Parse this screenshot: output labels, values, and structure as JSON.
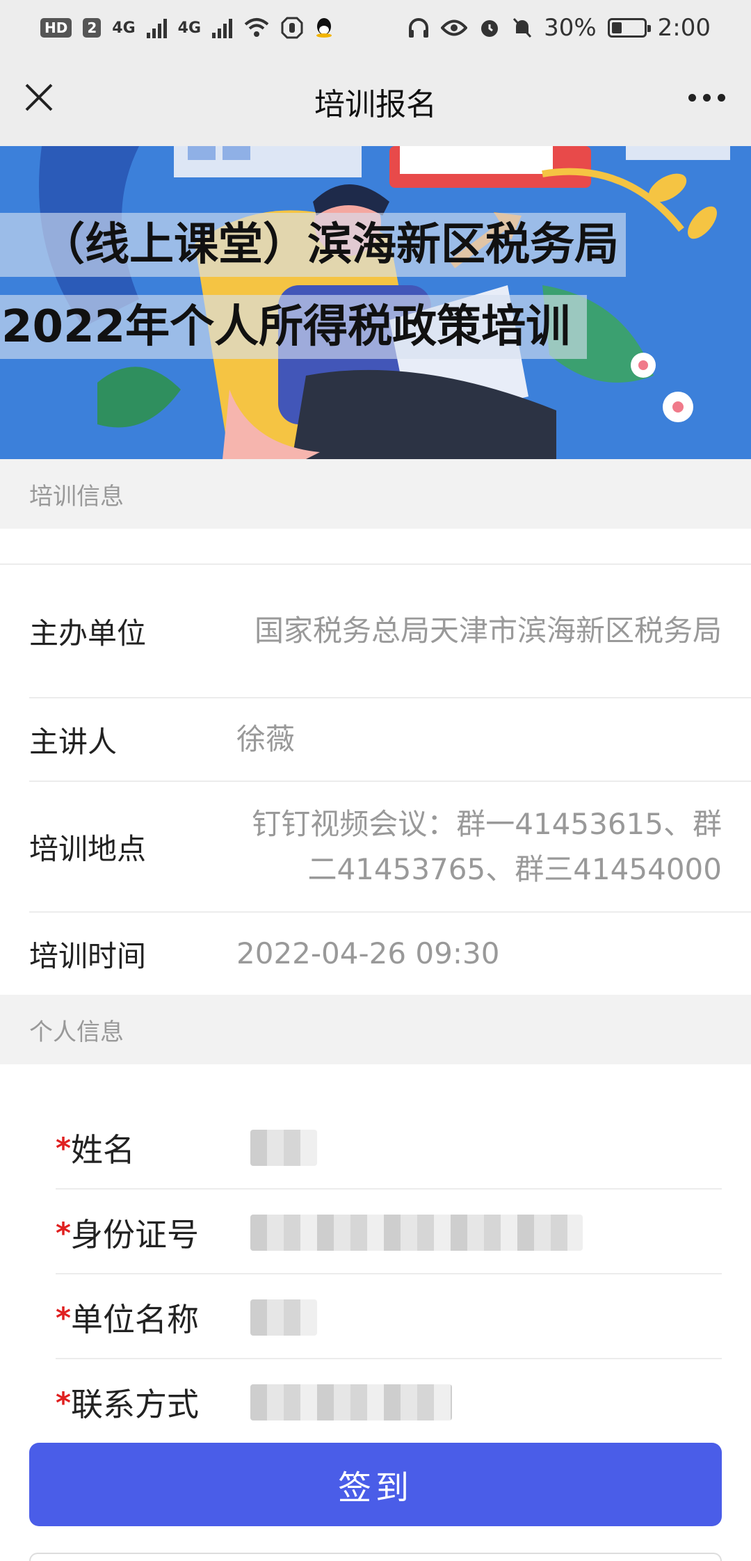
{
  "status_bar": {
    "hd_label": "HD",
    "sim_label": "2",
    "network1": "4G",
    "network2": "4G",
    "battery_percent": "30%",
    "time": "2:00"
  },
  "nav": {
    "title": "培训报名",
    "close_icon": "close-icon",
    "more_icon": "more-icon"
  },
  "banner": {
    "line1": "（线上课堂）滨海新区税务局",
    "line2": "2022年个人所得税政策培训"
  },
  "training_info": {
    "header": "培训信息",
    "rows": [
      {
        "label": "主办单位",
        "value": "国家税务总局天津市滨海新区税务局"
      },
      {
        "label": "主讲人",
        "value": "徐薇"
      },
      {
        "label": "培训地点",
        "value": "钉钉视频会议：群一41453615、群二41453765、群三41454000"
      },
      {
        "label": "培训时间",
        "value": "2022-04-26 09:30"
      }
    ]
  },
  "personal_info": {
    "header": "个人信息",
    "required_mark": "*",
    "fields": [
      {
        "label": "姓名"
      },
      {
        "label": "身份证号"
      },
      {
        "label": "单位名称"
      },
      {
        "label": "联系方式"
      }
    ]
  },
  "submit_label": "签到",
  "colors": {
    "accent": "#4a5de8",
    "required": "#e02020",
    "section_bg": "#f2f2f2",
    "banner_bg": "#3a7fd9"
  }
}
